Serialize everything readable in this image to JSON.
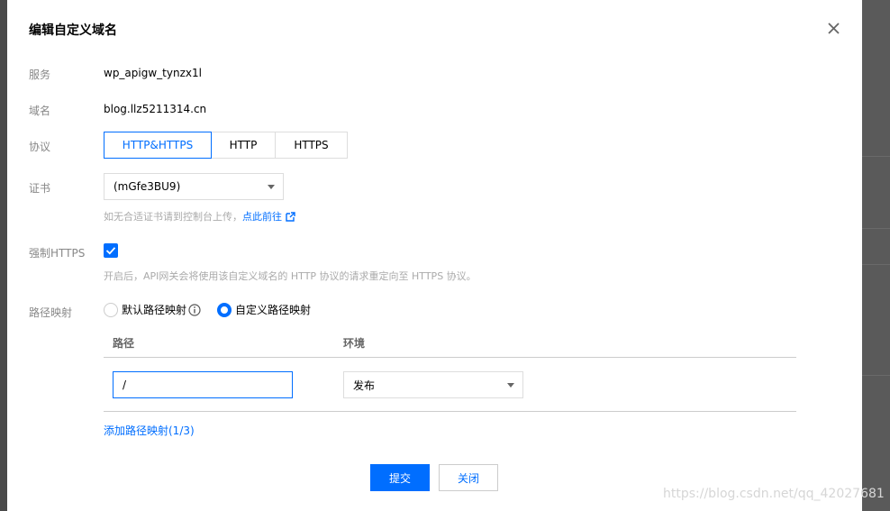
{
  "dialog": {
    "title": "编辑自定义域名"
  },
  "fields": {
    "service_label": "服务",
    "service_value": "wp_apigw_tynzx1l",
    "domain_label": "域名",
    "domain_value": "blog.llz5211314.cn",
    "protocol_label": "协议",
    "protocol_options": [
      "HTTP&HTTPS",
      "HTTP",
      "HTTPS"
    ],
    "protocol_selected": "HTTP&HTTPS",
    "cert_label": "证书",
    "cert_value": "(mGfe3BU9)",
    "cert_hint": "如无合适证书请到控制台上传，",
    "cert_hint_link": "点此前往",
    "force_https_label": "强制HTTPS",
    "force_https_checked": true,
    "force_https_hint": "开启后，API网关会将使用该自定义域名的 HTTP 协议的请求重定向至 HTTPS 协议。",
    "path_mapping_label": "路径映射",
    "path_mapping_default": "默认路径映射",
    "path_mapping_custom": "自定义路径映射",
    "path_mapping_selected": "自定义路径映射"
  },
  "mapping_table": {
    "col_path": "路径",
    "col_env": "环境",
    "rows": [
      {
        "path": "/",
        "env": "发布"
      }
    ],
    "add_link": "添加路径映射(1/3)"
  },
  "footer": {
    "submit": "提交",
    "close": "关闭"
  },
  "watermark": "https://blog.csdn.net/qq_42027681",
  "colors": {
    "accent": "#006eff",
    "label": "#888888",
    "hint": "#aaaaaa"
  }
}
